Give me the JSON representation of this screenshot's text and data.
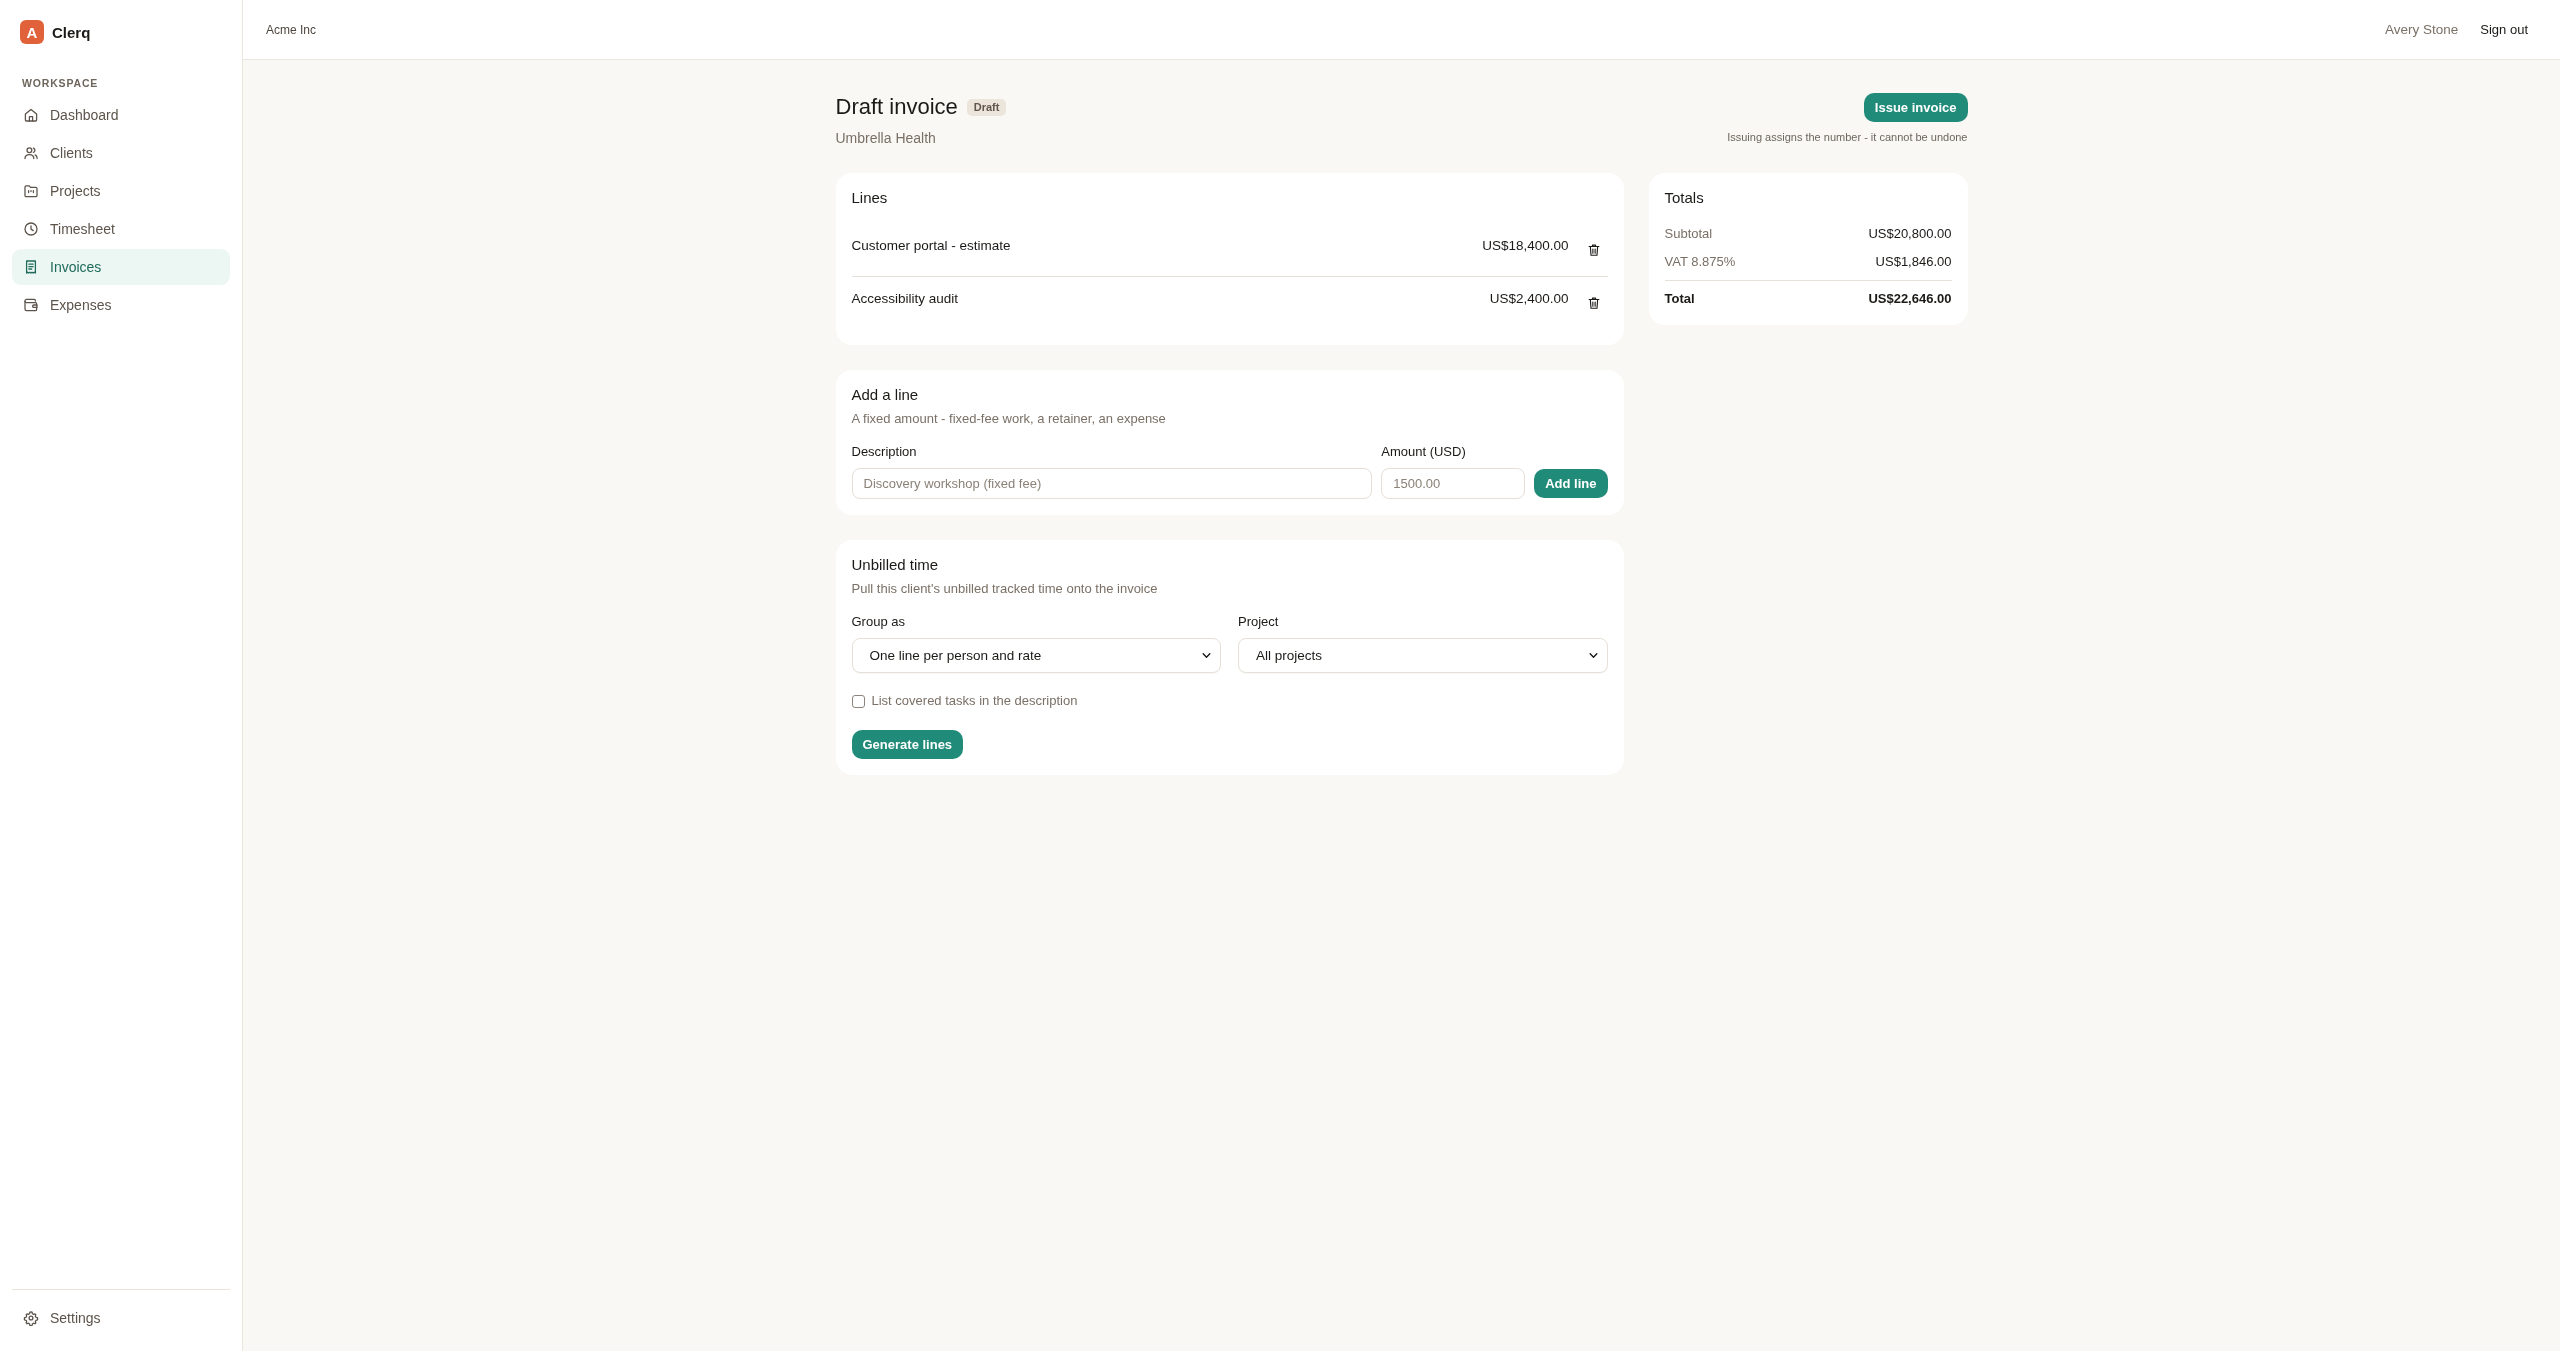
{
  "sidebar": {
    "brand": {
      "logo_letter": "A",
      "name": "Clerq"
    },
    "section_label": "WORKSPACE",
    "items": [
      {
        "label": "Dashboard",
        "kind": "dashboard",
        "selected": false
      },
      {
        "label": "Clients",
        "kind": "clients",
        "selected": false
      },
      {
        "label": "Projects",
        "kind": "projects",
        "selected": false
      },
      {
        "label": "Timesheet",
        "kind": "timesheet",
        "selected": false
      },
      {
        "label": "Invoices",
        "kind": "invoices",
        "selected": true
      },
      {
        "label": "Expenses",
        "kind": "expenses",
        "selected": false
      }
    ],
    "footer_items": [
      {
        "label": "Settings",
        "kind": "settings",
        "selected": false
      }
    ]
  },
  "top_bar": {
    "organization": "Acme Inc",
    "user_name": "Avery Stone",
    "sign_out": "Sign out"
  },
  "header": {
    "title": "Draft invoice",
    "status_badge": "Draft",
    "client": "Umbrella Health",
    "primary_action": "Issue invoice",
    "action_note": "Issuing assigns the number - it cannot be undone"
  },
  "lines_card": {
    "title": "Lines",
    "lines": [
      {
        "description": "Customer portal - estimate",
        "amount": "US$18,400.00"
      },
      {
        "description": "Accessibility audit",
        "amount": "US$2,400.00"
      }
    ]
  },
  "totals_card": {
    "title": "Totals",
    "rows": [
      {
        "label": "Subtotal",
        "value": "US$20,800.00",
        "kind": "regular"
      },
      {
        "label": "VAT 8.875%",
        "value": "US$1,846.00",
        "kind": "regular"
      },
      {
        "label": "Total",
        "value": "US$22,646.00",
        "kind": "total"
      }
    ]
  },
  "add_line_card": {
    "title": "Add a line",
    "subtitle": "A fixed amount - fixed-fee work, a retainer, an expense",
    "description_field": {
      "label": "Description",
      "placeholder": "Discovery workshop (fixed fee)"
    },
    "amount_field": {
      "label": "Amount (USD)",
      "placeholder": "1500.00"
    },
    "button": "Add line"
  },
  "unbilled_time_card": {
    "title": "Unbilled time",
    "subtitle": "Pull this client's unbilled tracked time onto the invoice",
    "group_select": {
      "label": "Group as",
      "value": "One line per person and rate"
    },
    "project_select": {
      "label": "Project",
      "value": "All projects"
    },
    "checkbox": {
      "label": "List covered tasks in the description",
      "checked": false
    },
    "button": "Generate lines"
  }
}
